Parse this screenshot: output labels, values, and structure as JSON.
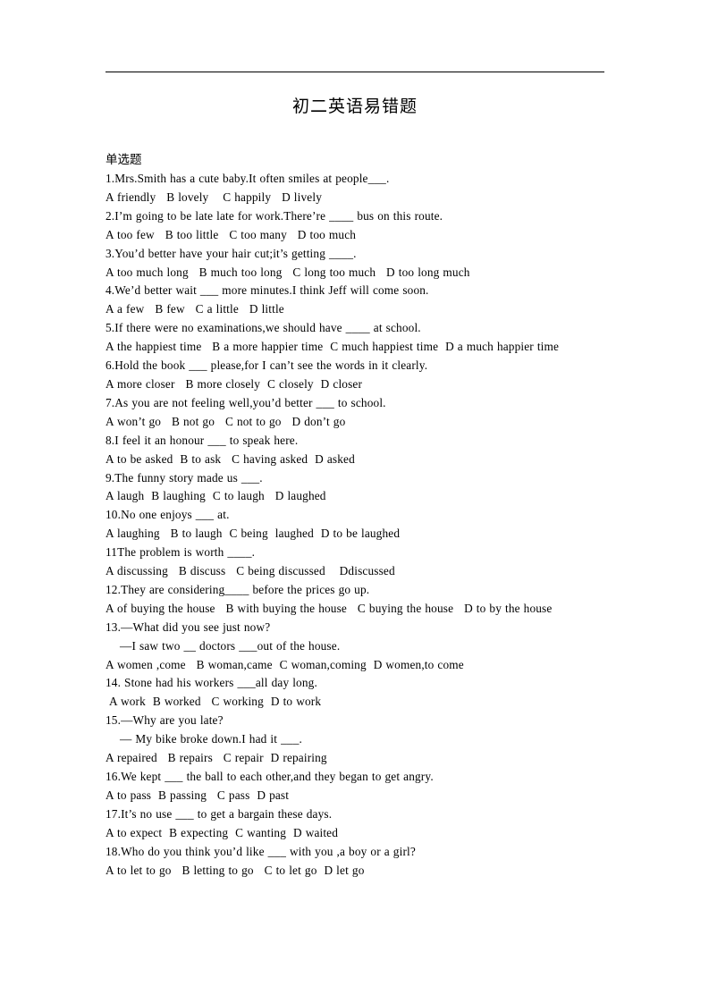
{
  "document": {
    "title": "初二英语易错题",
    "section_heading": "单选题"
  },
  "questions": [
    {
      "id": "q1",
      "stem": "1.Mrs.Smith has a cute baby.It often smiles at people___.",
      "options": "A friendly   B lovely    C happily   D lively"
    },
    {
      "id": "q2",
      "stem": "2.I’m going to be late late for work.There’re ____ bus on this route.",
      "options": "A too few   B too little   C too many   D too much"
    },
    {
      "id": "q3",
      "stem": "3.You’d better have your hair cut;it’s getting ____.",
      "options": "A too much long   B much too long   C long too much   D too long much"
    },
    {
      "id": "q4",
      "stem": "4.We’d better wait ___ more minutes.I think Jeff will come soon.",
      "options": "A a few   B few   C a little   D little"
    },
    {
      "id": "q5",
      "stem": "5.If there were no examinations,we should have ____ at school.",
      "options": "A the happiest time   B a more happier time  C much happiest time  D a much happier time"
    },
    {
      "id": "q6",
      "stem": "6.Hold the book ___ please,for I can’t see the words in it clearly.",
      "options": "A more closer   B more closely  C closely  D closer"
    },
    {
      "id": "q7",
      "stem": "7.As you are not feeling well,you’d better ___ to school.",
      "options": "A won’t go   B not go   C not to go   D don’t go"
    },
    {
      "id": "q8",
      "stem": "8.I feel it an honour ___ to speak here.",
      "options": "A to be asked  B to ask   C having asked  D asked"
    },
    {
      "id": "q9",
      "stem": "9.The funny story made us ___.",
      "options": "A laugh  B laughing  C to laugh   D laughed"
    },
    {
      "id": "q10",
      "stem": "10.No one enjoys ___ at.",
      "options": "A laughing   B to laugh  C being  laughed  D to be laughed"
    },
    {
      "id": "q11",
      "stem": "11The problem is worth ____.",
      "options": "A discussing   B discuss   C being discussed    Ddiscussed"
    },
    {
      "id": "q12",
      "stem": "12.They are considering____ before the prices go up.",
      "options": "A of buying the house   B with buying the house   C buying the house   D to by the house"
    },
    {
      "id": "q13",
      "stem": "13.—What did you see just now?",
      "stem2": "—I saw two __ doctors ___out of the house.",
      "options": "A women ,come   B woman,came  C woman,coming  D women,to come"
    },
    {
      "id": "q14",
      "stem": "14. Stone had his workers ___all day long.",
      "options": " A work  B worked   C working  D to work"
    },
    {
      "id": "q15",
      "stem": "15.—Why are you late?",
      "stem2": "— My bike broke down.I had it ___.",
      "options": "A repaired   B repairs   C repair  D repairing"
    },
    {
      "id": "q16",
      "stem": "16.We kept ___ the ball to each other,and they began to get angry.",
      "options": "A to pass  B passing   C pass  D past"
    },
    {
      "id": "q17",
      "stem": "17.It’s no use ___ to get a bargain these days.",
      "options": "A to expect  B expecting  C wanting  D waited"
    },
    {
      "id": "q18",
      "stem": "18.Who do you think you’d like ___ with you ,a boy or a girl?",
      "options": "A to let to go   B letting to go   C to let go  D let go"
    }
  ]
}
